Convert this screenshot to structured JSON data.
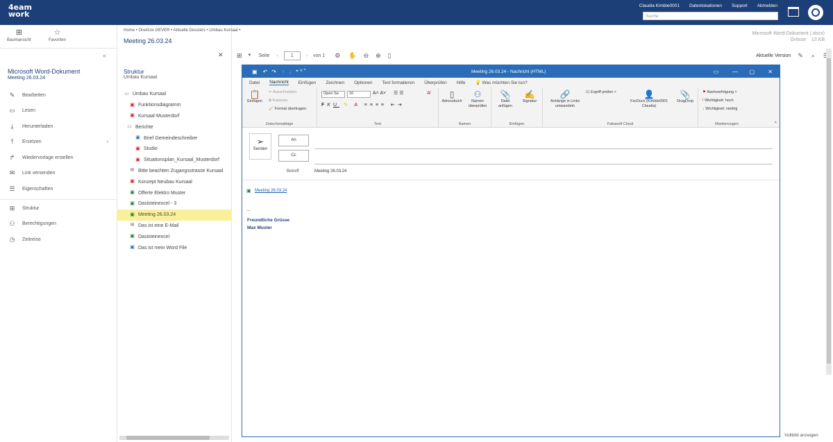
{
  "topbar": {
    "logo_line1": "4eam",
    "logo_line2": "work",
    "user": "Claudia Kimble0001",
    "links": [
      "Datenlokationen",
      "Support",
      "Abmelden"
    ],
    "search_placeholder": "Suche"
  },
  "toolrow": {
    "tree_label": "Baumansicht",
    "favorites_label": "Favoriten"
  },
  "left": {
    "title": "Microsoft Word-Dokument",
    "subtitle": "Meeting 26.03.24",
    "menu": [
      "Bearbeiten",
      "Lesen",
      "Herunterladen",
      "Ersetzen",
      "Wiedervorlage erstellen",
      "Link versenden",
      "Eigenschaften"
    ],
    "menu2": [
      "Struktur",
      "Berechtigungen",
      "Zeitreise"
    ]
  },
  "breadcrumb": "Home  •  OneGov GEVER  •  Aktuelle Dossiers  •  Umbau Kursaal  •",
  "page_title": "Meeting 26.03.24",
  "structure": {
    "title": "Struktur",
    "subtitle": "Umbau Kursaal",
    "items": [
      "Umbau Kursaal",
      "Funktionsdiagramm",
      "Kursaal-Musterdorf",
      "Berichte",
      "Brief Gemeindeschreiber",
      "Studie",
      "Situationsplan_Kursaal_Musterdorf",
      "Bitte beachten Zugangsstrasse Kursaal",
      "Konzept Neubau Kursaal",
      "Offerte Elektro Muster",
      "Dasisteinexcel - 3",
      "Meeting 26.03.24",
      "Das ist eine E-Mail",
      "Dasisteinexcel",
      "Das ist mein Word File"
    ]
  },
  "viewer": {
    "page_label": "Seite",
    "page_num": "1",
    "page_of": "von 1",
    "version_label": "Aktuelle Version",
    "doc_type": "Microsoft Word-Dokument (.docx)",
    "size_label": "Grösse",
    "size_value": "13 KB",
    "fullscreen": "Vollbild anzeigen"
  },
  "outlook": {
    "title": "Meeting 26.03.24  -  Nachricht (HTML)",
    "tabs": [
      "Datei",
      "Nachricht",
      "Einfügen",
      "Zeichnen",
      "Optionen",
      "Text formatieren",
      "Überprüfen",
      "Hilfe",
      "Was möchten Sie tun?"
    ],
    "clipboard": {
      "paste": "Einfügen",
      "cut": "Ausschneiden",
      "copy": "Kopieren",
      "format": "Format übertragen",
      "label": "Zwischenablage"
    },
    "font": {
      "name": "Open Sa",
      "size": "10",
      "label": "Text"
    },
    "names": {
      "addressbook": "Adressbuch",
      "check": "Namen überprüfen",
      "label": "Namen"
    },
    "include": {
      "attach": "Datei anfügen",
      "signature": "Signatur",
      "label": "Einfügen"
    },
    "fabasoft": {
      "links": "Anhänge in Links umwandeln",
      "access": "Zugriff prüfen",
      "user": "FscDucx (Kimble0001 Claudia)",
      "dragdrop": "DragDrop",
      "label": "Fabasoft Cloud"
    },
    "tags": {
      "followup": "Nachverfolgung",
      "high": "Wichtigkeit: hoch",
      "low": "Wichtigkeit: niedrig",
      "label": "Markierungen"
    },
    "send": "Senden",
    "to": "An",
    "cc": "Cc",
    "subject_label": "Betreff",
    "subject": "Meeting 26.03.24",
    "attachment": "Meeting 26.03.24",
    "sig_dash": "--",
    "sig1": "Freundliche Grüsse",
    "sig2": "Max Muster"
  }
}
